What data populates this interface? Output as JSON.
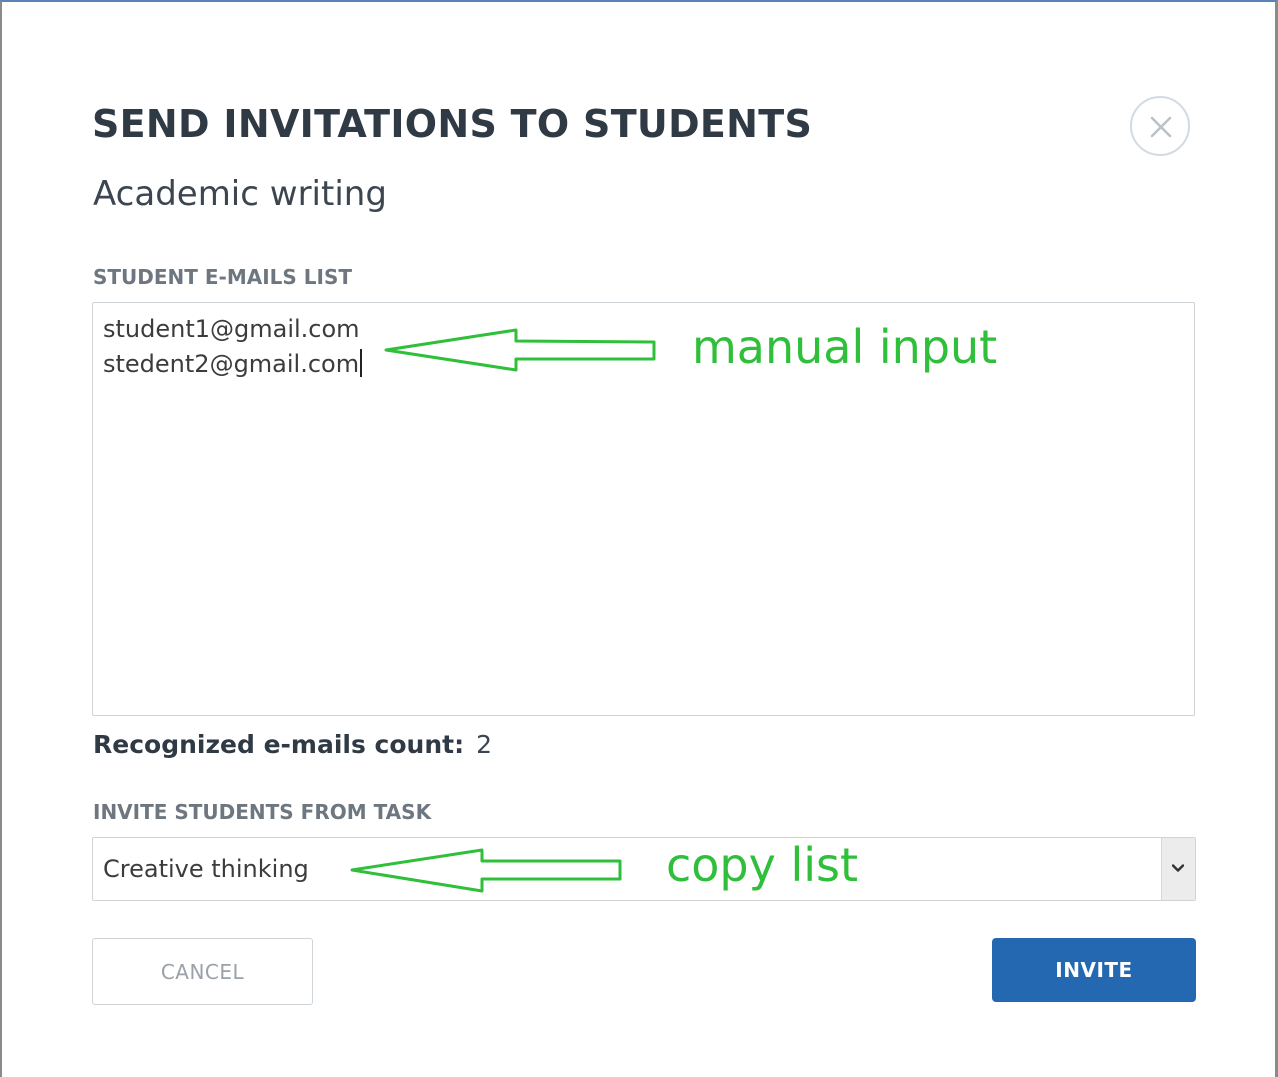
{
  "dialog": {
    "title": "SEND INVITATIONS TO STUDENTS",
    "subtitle": "Academic writing"
  },
  "emails_section": {
    "label": "STUDENT E-MAILS LIST",
    "lines": [
      "student1@gmail.com",
      "stedent2@gmail.com"
    ]
  },
  "recognized": {
    "label": "Recognized e-mails count:",
    "count": "2"
  },
  "task_section": {
    "label": "INVITE STUDENTS FROM TASK",
    "selected": "Creative thinking"
  },
  "buttons": {
    "cancel": "CANCEL",
    "invite": "INVITE"
  },
  "annotations": {
    "manual_input": "manual input",
    "copy_list": "copy list",
    "color": "#2fbf3a"
  },
  "colors": {
    "primary_button": "#2468b1",
    "title_text": "#2f3a45",
    "label_text": "#6e7780"
  },
  "icons": {
    "close": "close-icon",
    "dropdown": "chevron-down-icon",
    "annotation_arrow": "left-arrow-icon"
  }
}
